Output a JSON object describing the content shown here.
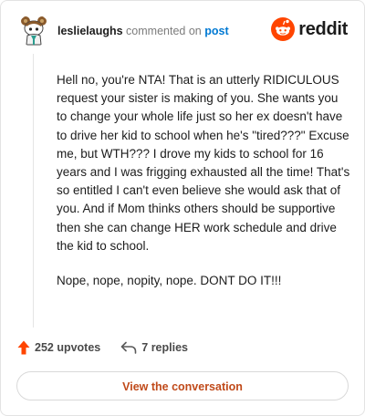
{
  "header": {
    "username": "leslielaughs",
    "action_text": "commented on",
    "target_link": "post",
    "brand_name": "reddit",
    "brand_color": "#ff4500"
  },
  "icons": {
    "avatar": "avatar-snoo-icon",
    "brand": "reddit-logo-icon",
    "upvote": "upvote-arrow-icon",
    "reply": "reply-arrow-icon"
  },
  "comment": {
    "paragraphs": [
      "Hell no, you're NTA! That is an utterly RIDICULOUS request your sister is making of you. She wants you to change your whole life just so her ex doesn't have to drive her kid to school when he's \"tired???\" Excuse me, but WTH??? I drove my kids to school for 16 years and I was frigging exhausted all the time! That's so entitled I can't even believe she would ask that of you. And if Mom thinks others should be supportive then she can change HER work schedule and drive the kid to school.",
      "Nope, nope, nopity, nope. DONT DO IT!!!"
    ]
  },
  "footer": {
    "upvotes": "252 upvotes",
    "replies": "7 replies",
    "upvote_color": "#ff4500"
  },
  "cta": {
    "label": "View the conversation",
    "color": "#c04a1a"
  }
}
